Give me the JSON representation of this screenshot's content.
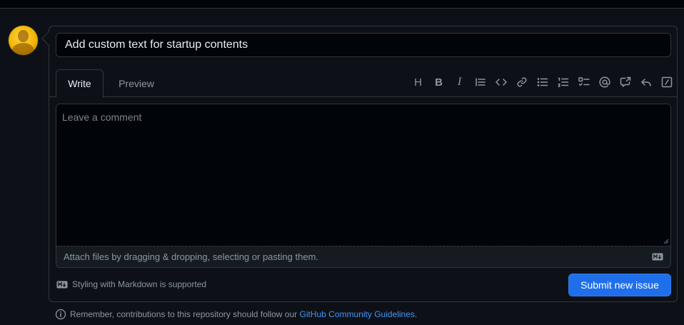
{
  "issue_form": {
    "title_value": "Add custom text for startup contents",
    "tabs": [
      {
        "label": "Write",
        "active": true
      },
      {
        "label": "Preview",
        "active": false
      }
    ],
    "toolbar_icons": [
      "heading-icon",
      "bold-icon",
      "italic-icon",
      "quote-icon",
      "code-icon",
      "link-icon",
      "unordered-list-icon",
      "ordered-list-icon",
      "task-list-icon",
      "mention-icon",
      "cross-reference-icon",
      "saved-reply-icon",
      "slash-commands-icon"
    ],
    "comment_placeholder": "Leave a comment",
    "attach_text": "Attach files by dragging & dropping, selecting or pasting them.",
    "markdown_note": "Styling with Markdown is supported",
    "submit_label": "Submit new issue",
    "guidelines_prefix": "Remember, contributions to this repository should follow our ",
    "guidelines_link": "GitHub Community Guidelines",
    "guidelines_suffix": "."
  },
  "colors": {
    "background": "#0d1117",
    "border": "#30363d",
    "accent": "#1f6feb",
    "link": "#4493f8",
    "muted_text": "#8d96a0"
  }
}
